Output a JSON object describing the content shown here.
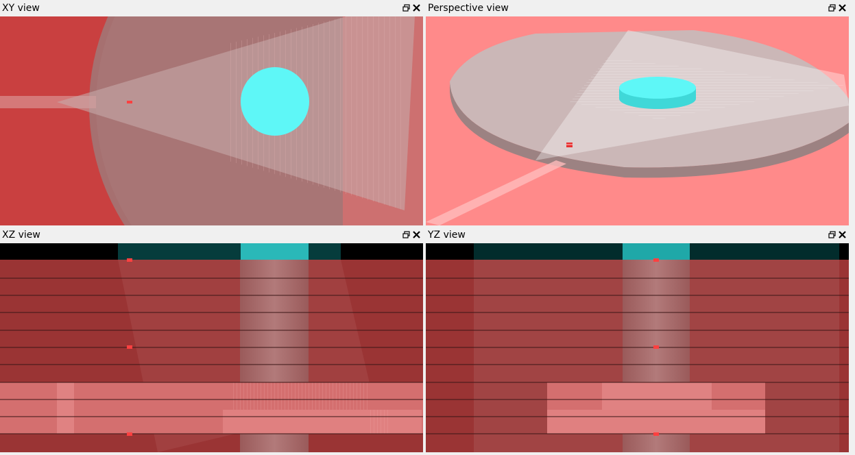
{
  "panes": {
    "xy": {
      "title": "XY view"
    },
    "perspective": {
      "title": "Perspective view"
    },
    "xz": {
      "title": "XZ view"
    },
    "yz": {
      "title": "YZ view"
    }
  },
  "icons": {
    "restore": "restore-window-icon",
    "close": "close-icon"
  },
  "colors": {
    "background_red": "#c94040",
    "perspective_background": "#ff8a8a",
    "cyan_cylinder": "#5ef7f7",
    "marker_red": "#ff4040",
    "dark_teal": "#003030"
  }
}
